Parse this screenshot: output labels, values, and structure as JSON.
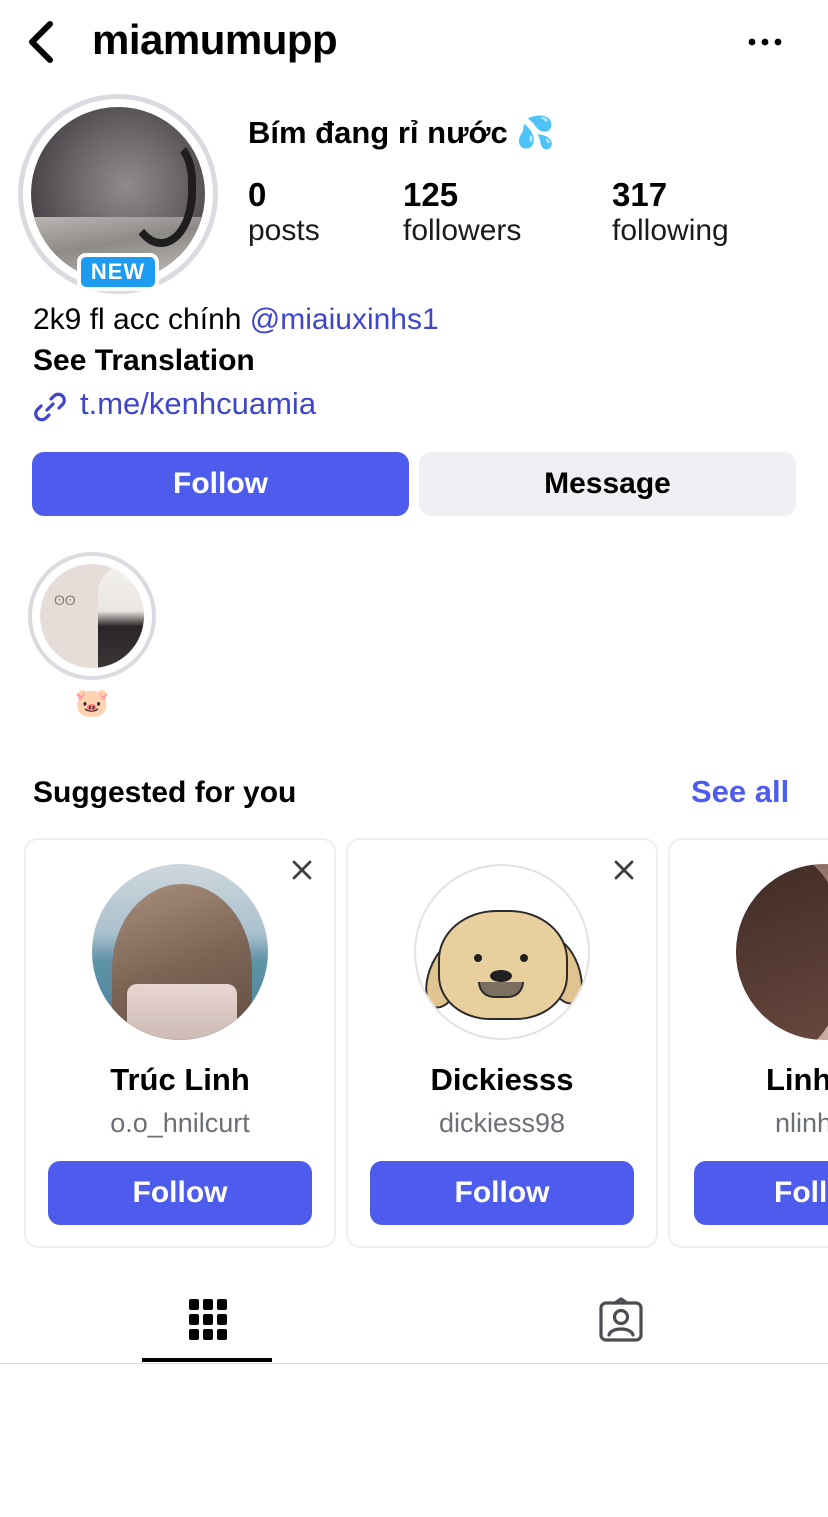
{
  "header": {
    "username": "miamumupp",
    "back_icon": "chevron-left-icon",
    "more_icon": "more-horizontal-icon"
  },
  "profile": {
    "badge": "NEW",
    "display_name": "Bím đang rỉ nước 💦",
    "stats": [
      {
        "value": "0",
        "label": "posts"
      },
      {
        "value": "125",
        "label": "followers"
      },
      {
        "value": "317",
        "label": "following"
      }
    ],
    "bio_text": "2k9 fl acc chính ",
    "bio_mention": "@miaiuxinhs1",
    "see_translation": "See Translation",
    "link": "t.me/kenhcuamia",
    "link_icon": "link-icon"
  },
  "actions": {
    "follow": "Follow",
    "message": "Message"
  },
  "highlights": [
    {
      "label": "🐷"
    }
  ],
  "suggested": {
    "title": "Suggested for you",
    "see_all": "See all",
    "cards": [
      {
        "name": "Trúc Linh",
        "handle": "o.o_hnilcurt",
        "button": "Follow"
      },
      {
        "name": "Dickiesss",
        "handle": "dickiess98",
        "button": "Follow"
      },
      {
        "name": "Linh",
        "handle": "nlinh",
        "button": "Follow"
      }
    ]
  },
  "tabs": [
    {
      "icon": "grid-icon",
      "active": true
    },
    {
      "icon": "tagged-icon",
      "active": false
    }
  ],
  "colors": {
    "accent": "#4e5ced",
    "link": "#3f46c9",
    "badge": "#1d9bf0",
    "secondary_button": "#eff0f4"
  }
}
